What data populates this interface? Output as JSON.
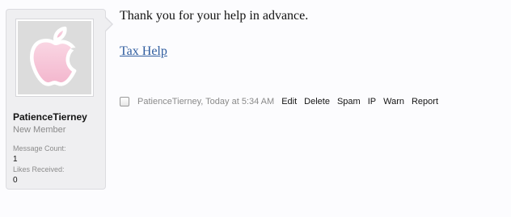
{
  "user": {
    "name": "PatienceTierney",
    "title": "New Member",
    "stats": [
      {
        "label": "Message Count:",
        "value": "1"
      },
      {
        "label": "Likes Received:",
        "value": "0"
      }
    ],
    "avatar_icon": "pink-apple-logo-icon",
    "avatar_color": "#f6c6d8"
  },
  "message": {
    "text": "Thank you for your help in advance.",
    "link": "Tax Help"
  },
  "meta": {
    "author_time": "PatienceTierney, Today at 5:34 AM",
    "actions": [
      "Edit",
      "Delete",
      "Spam",
      "IP",
      "Warn",
      "Report"
    ]
  },
  "colors": {
    "link": "#2f5d9f",
    "card_bg": "#efeff1"
  }
}
